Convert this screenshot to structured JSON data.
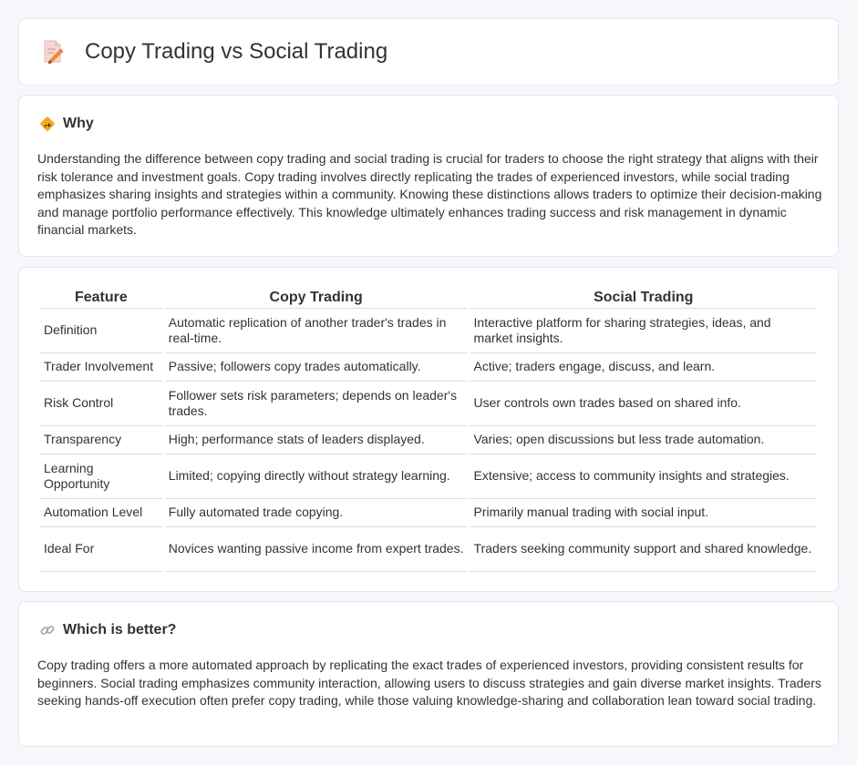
{
  "header": {
    "title": "Copy Trading vs Social Trading",
    "icon": "document-pencil-icon"
  },
  "why": {
    "icon": "diamond-signpost-icon",
    "title": "Why",
    "text": "Understanding the difference between copy trading and social trading is crucial for traders to choose the right strategy that aligns with their risk tolerance and investment goals. Copy trading involves directly replicating the trades of experienced investors, while social trading emphasizes sharing insights and strategies within a community. Knowing these distinctions allows traders to optimize their decision-making and manage portfolio performance effectively. This knowledge ultimately enhances trading success and risk management in dynamic financial markets."
  },
  "table": {
    "headers": [
      "Feature",
      "Copy Trading",
      "Social Trading"
    ],
    "rows": [
      [
        "Definition",
        "Automatic replication of another trader's trades in real-time.",
        "Interactive platform for sharing strategies, ideas, and market insights."
      ],
      [
        "Trader Involvement",
        "Passive; followers copy trades automatically.",
        "Active; traders engage, discuss, and learn."
      ],
      [
        "Risk Control",
        "Follower sets risk parameters; depends on leader's trades.",
        "User controls own trades based on shared info."
      ],
      [
        "Transparency",
        "High; performance stats of leaders displayed.",
        "Varies; open discussions but less trade automation."
      ],
      [
        "Learning Opportunity",
        "Limited; copying directly without strategy learning.",
        "Extensive; access to community insights and strategies."
      ],
      [
        "Automation Level",
        "Fully automated trade copying.",
        "Primarily manual trading with social input."
      ],
      [
        "Ideal For",
        "Novices wanting passive income from expert trades.",
        "Traders seeking community support and shared knowledge."
      ]
    ]
  },
  "better": {
    "icon": "link-icon",
    "title": "Which is better?",
    "text": "Copy trading offers a more automated approach by replicating the exact trades of experienced investors, providing consistent results for beginners. Social trading emphasizes community interaction, allowing users to discuss strategies and gain diverse market insights. Traders seeking hands-off execution often prefer copy trading, while those valuing knowledge-sharing and collaboration lean toward social trading."
  },
  "colors": {
    "page_bg": "#f5f7fa",
    "card_bg": "#ffffff",
    "border": "#e3e6ea",
    "text": "#333333",
    "row_divider": "#dddddd"
  }
}
